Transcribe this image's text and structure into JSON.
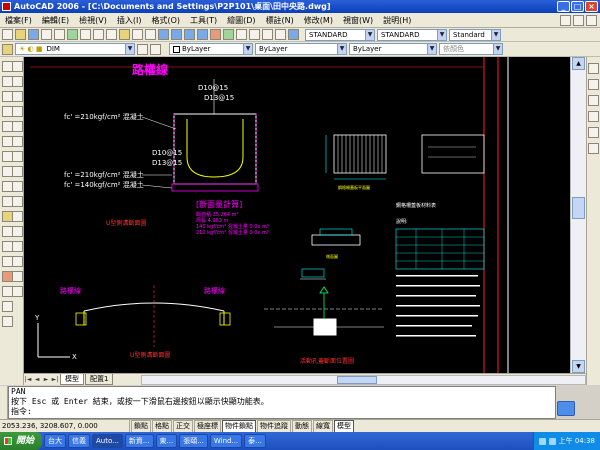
{
  "window": {
    "title": "AutoCAD 2006 - [C:\\Documents and Settings\\P2P101\\桌面\\田中央路.dwg]",
    "controls": {
      "minimize": "_",
      "maximize": "□",
      "close": "×"
    }
  },
  "menu": {
    "items": [
      "檔案(F)",
      "編輯(E)",
      "檢視(V)",
      "插入(I)",
      "格式(O)",
      "工具(T)",
      "繪圖(D)",
      "標註(N)",
      "修改(M)",
      "視窗(W)",
      "說明(H)"
    ]
  },
  "toolbar": {
    "text_style": "STANDARD",
    "dim_style": "STANDARD",
    "table_style": "Standard",
    "layer": "DIM",
    "color": "ByLayer",
    "linetype": "ByLayer",
    "lineweight": "ByLayer",
    "plot_style": "依顏色"
  },
  "drawing": {
    "title": "路權線",
    "rebar_labels": [
      "D10@15",
      "D13@15",
      "D10@15",
      "D13@15"
    ],
    "concrete_labels": [
      "fc' =210kgf/cm² 混凝土",
      "fc' =210kgf/cm² 混凝土",
      "fc' =140kgf/cm² 混凝土"
    ],
    "section_label": "U型側溝斷面圖",
    "calc_title": "[斷面量計算]",
    "calc_lines": [
      "斷面積 35.264 m²",
      "周長 4.963 m",
      "140 kgf/cm² 混凝土量 0.0x m³",
      "210 kgf/cm² 混凝土量 0.0x m³"
    ],
    "lower_left_label": "路權線",
    "lower_mid_label": "路權線",
    "lower_section_label": "U型側溝斷面圖",
    "lower_right_label": "活動孔蓋斷面位置圖",
    "plan_caption": "鋼格柵蓋板平面圖",
    "side_caption": "側面圖",
    "table_title": "鋼格柵蓋板材料表",
    "notes_title": "說明:",
    "axis_x": "X",
    "axis_y": "Y"
  },
  "tabs": {
    "nav": [
      "|◄",
      "◄",
      "►",
      "►|"
    ],
    "model": "模型",
    "layout": "配置1"
  },
  "command": {
    "lines": [
      "PAN",
      "按下 Esc 或 Enter 結束，或按一下滑鼠右邊按鈕以顯示快顯功能表。"
    ],
    "prompt": "指令:"
  },
  "status": {
    "coords": "2053.236, 3208.607, 0.000",
    "buttons": [
      {
        "label": "鎖點",
        "on": false
      },
      {
        "label": "格點",
        "on": false
      },
      {
        "label": "正交",
        "on": false
      },
      {
        "label": "極座標",
        "on": false
      },
      {
        "label": "物件鎖點",
        "on": true
      },
      {
        "label": "物件追蹤",
        "on": false
      },
      {
        "label": "動態",
        "on": false
      },
      {
        "label": "線寬",
        "on": false
      },
      {
        "label": "模型",
        "on": true
      }
    ]
  },
  "taskbar": {
    "start": "開始",
    "tasks": [
      "台大",
      "信義",
      "Auto...",
      "新資...",
      "東...",
      "張頤...",
      "Wind...",
      "泰..."
    ],
    "clock": "上午 04:38"
  },
  "colors": {
    "magenta": "#ff00ff",
    "cyan": "#00ffff",
    "yellow": "#ffff00",
    "white": "#ffffff",
    "red": "#ff3030",
    "green": "#00ff66"
  }
}
